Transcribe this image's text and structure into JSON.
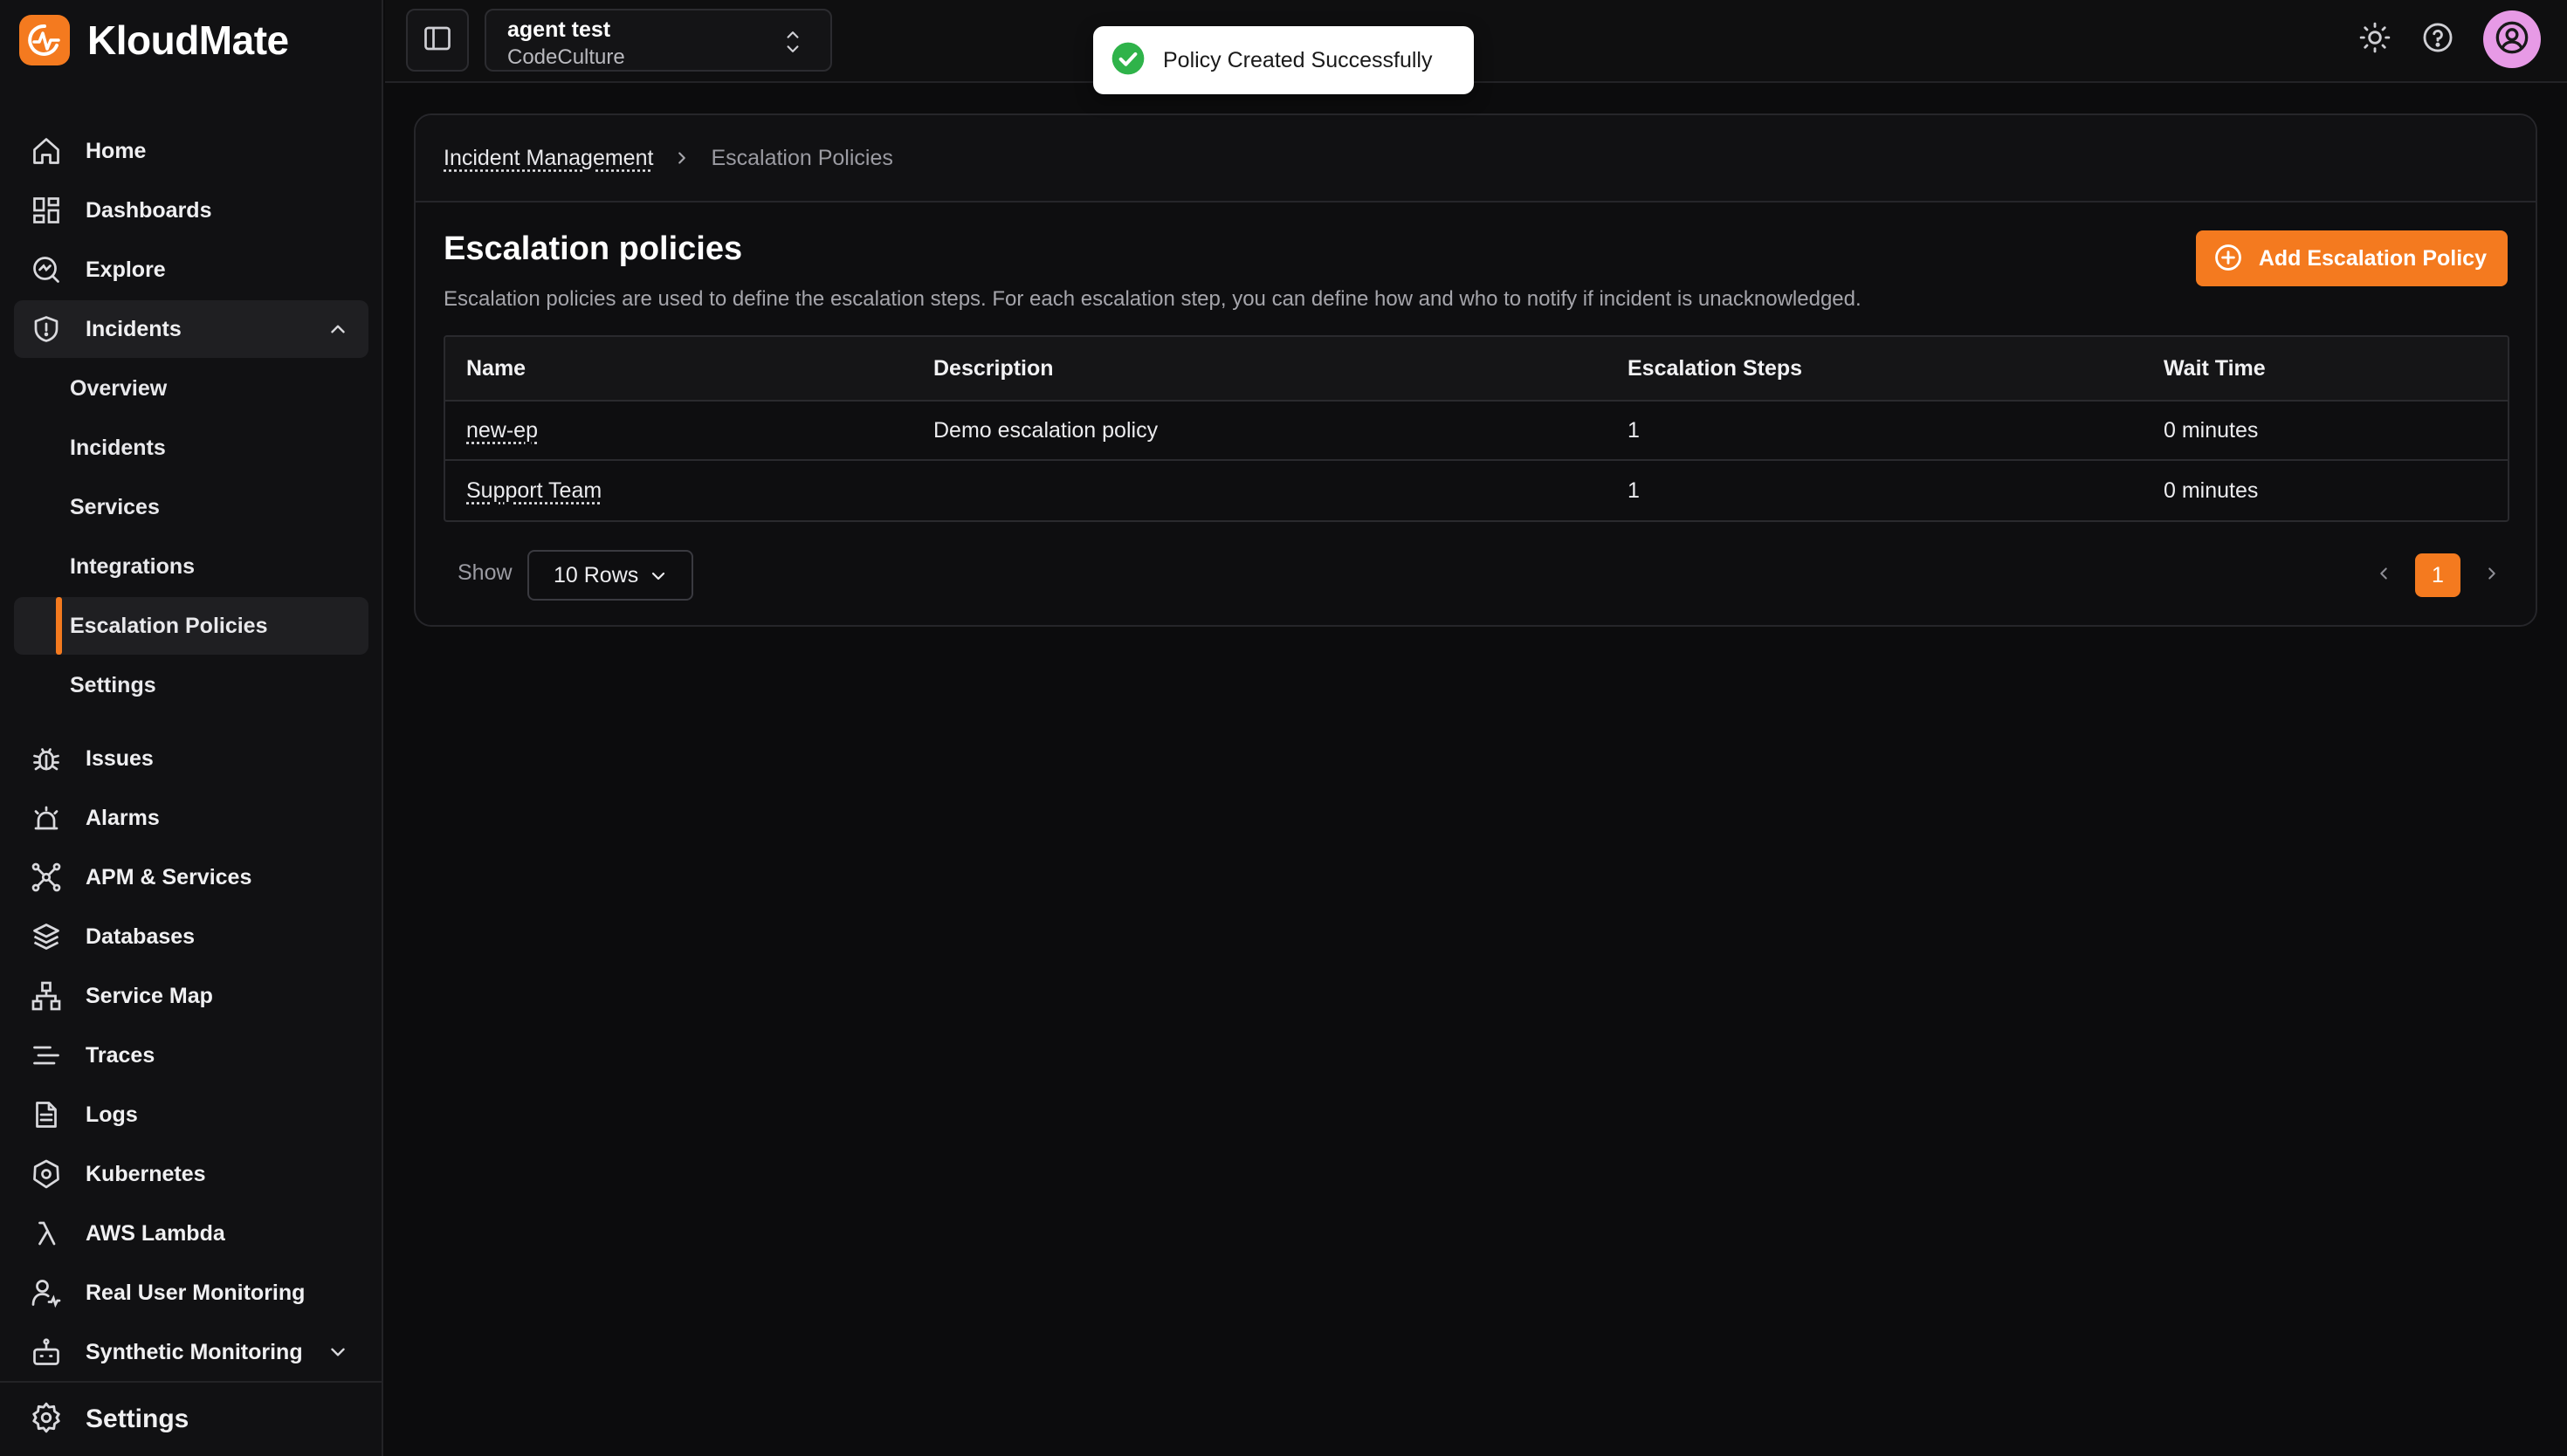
{
  "brand": {
    "name": "KloudMate",
    "accent": "#f47a1f"
  },
  "sidebar": {
    "items": [
      {
        "label": "Home",
        "icon": "home-icon"
      },
      {
        "label": "Dashboards",
        "icon": "dashboards-icon"
      },
      {
        "label": "Explore",
        "icon": "explore-icon"
      },
      {
        "label": "Incidents",
        "icon": "shield-icon",
        "expanded": true
      }
    ],
    "incidents_sub": [
      {
        "label": "Overview"
      },
      {
        "label": "Incidents"
      },
      {
        "label": "Services"
      },
      {
        "label": "Integrations"
      },
      {
        "label": "Escalation Policies",
        "active": true
      },
      {
        "label": "Settings"
      }
    ],
    "items2": [
      {
        "label": "Issues",
        "icon": "bug-icon"
      },
      {
        "label": "Alarms",
        "icon": "alarm-icon"
      },
      {
        "label": "APM & Services",
        "icon": "apm-icon"
      },
      {
        "label": "Databases",
        "icon": "database-icon"
      },
      {
        "label": "Service Map",
        "icon": "service-map-icon"
      },
      {
        "label": "Traces",
        "icon": "traces-icon"
      },
      {
        "label": "Logs",
        "icon": "logs-icon"
      },
      {
        "label": "Kubernetes",
        "icon": "kubernetes-icon"
      },
      {
        "label": "AWS Lambda",
        "icon": "lambda-icon"
      },
      {
        "label": "Real User Monitoring",
        "icon": "rum-icon"
      },
      {
        "label": "Synthetic Monitoring",
        "icon": "robot-icon"
      }
    ],
    "settings_label": "Settings"
  },
  "topbar": {
    "org_name": "agent test",
    "org_sub": "CodeCulture"
  },
  "toast": {
    "text": "Policy Created Successfully"
  },
  "breadcrumb": {
    "parent": "Incident Management",
    "current": "Escalation Policies"
  },
  "page": {
    "title": "Escalation policies",
    "description": "Escalation policies are used to define the escalation steps. For each escalation step, you can define how and who to notify if incident is unacknowledged.",
    "add_button": "Add Escalation Policy"
  },
  "table": {
    "columns": [
      "Name",
      "Description",
      "Escalation Steps",
      "Wait Time"
    ],
    "rows": [
      {
        "name": "new-ep",
        "description": "Demo escalation policy",
        "steps": "1",
        "wait": "0 minutes"
      },
      {
        "name": "Support Team",
        "description": "",
        "steps": "1",
        "wait": "0 minutes"
      }
    ]
  },
  "pagination": {
    "show_label": "Show",
    "rows_value": "10 Rows",
    "current_page": "1"
  }
}
